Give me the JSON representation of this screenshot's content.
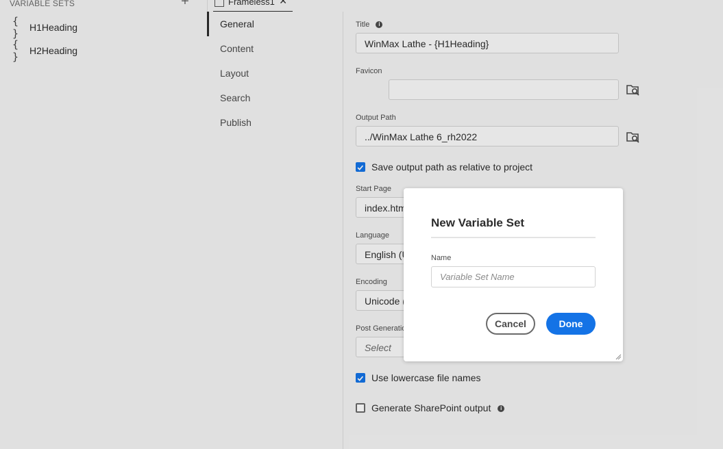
{
  "variable_sets": {
    "header": "VARIABLE SETS",
    "add_icon": "plus-icon",
    "items": [
      {
        "label": "H1Heading"
      },
      {
        "label": "H2Heading"
      }
    ]
  },
  "tab": {
    "label": "Frameless1",
    "close": "✕"
  },
  "nav": {
    "items": [
      {
        "label": "General"
      },
      {
        "label": "Content"
      },
      {
        "label": "Layout"
      },
      {
        "label": "Search"
      },
      {
        "label": "Publish"
      }
    ]
  },
  "form": {
    "title_label": "Title",
    "title_value": "WinMax Lathe - {H1Heading}",
    "favicon_label": "Favicon",
    "favicon_value": "",
    "output_path_label": "Output Path",
    "output_path_value": "../WinMax Lathe 6_rh2022",
    "save_relative_label": "Save output path as relative to project",
    "start_page_label": "Start Page",
    "start_page_value": "index.htm",
    "language_label": "Language",
    "language_value": "English (U",
    "encoding_label": "Encoding",
    "encoding_value": "Unicode (U",
    "post_generation_label": "Post Generatio",
    "post_generation_value": "Select",
    "lowercase_label": "Use lowercase file names",
    "sharepoint_label": "Generate SharePoint output"
  },
  "dialog": {
    "title": "New Variable Set",
    "name_label": "Name",
    "name_placeholder": "Variable Set Name",
    "cancel_label": "Cancel",
    "done_label": "Done"
  },
  "colors": {
    "accent": "#1473e6"
  }
}
